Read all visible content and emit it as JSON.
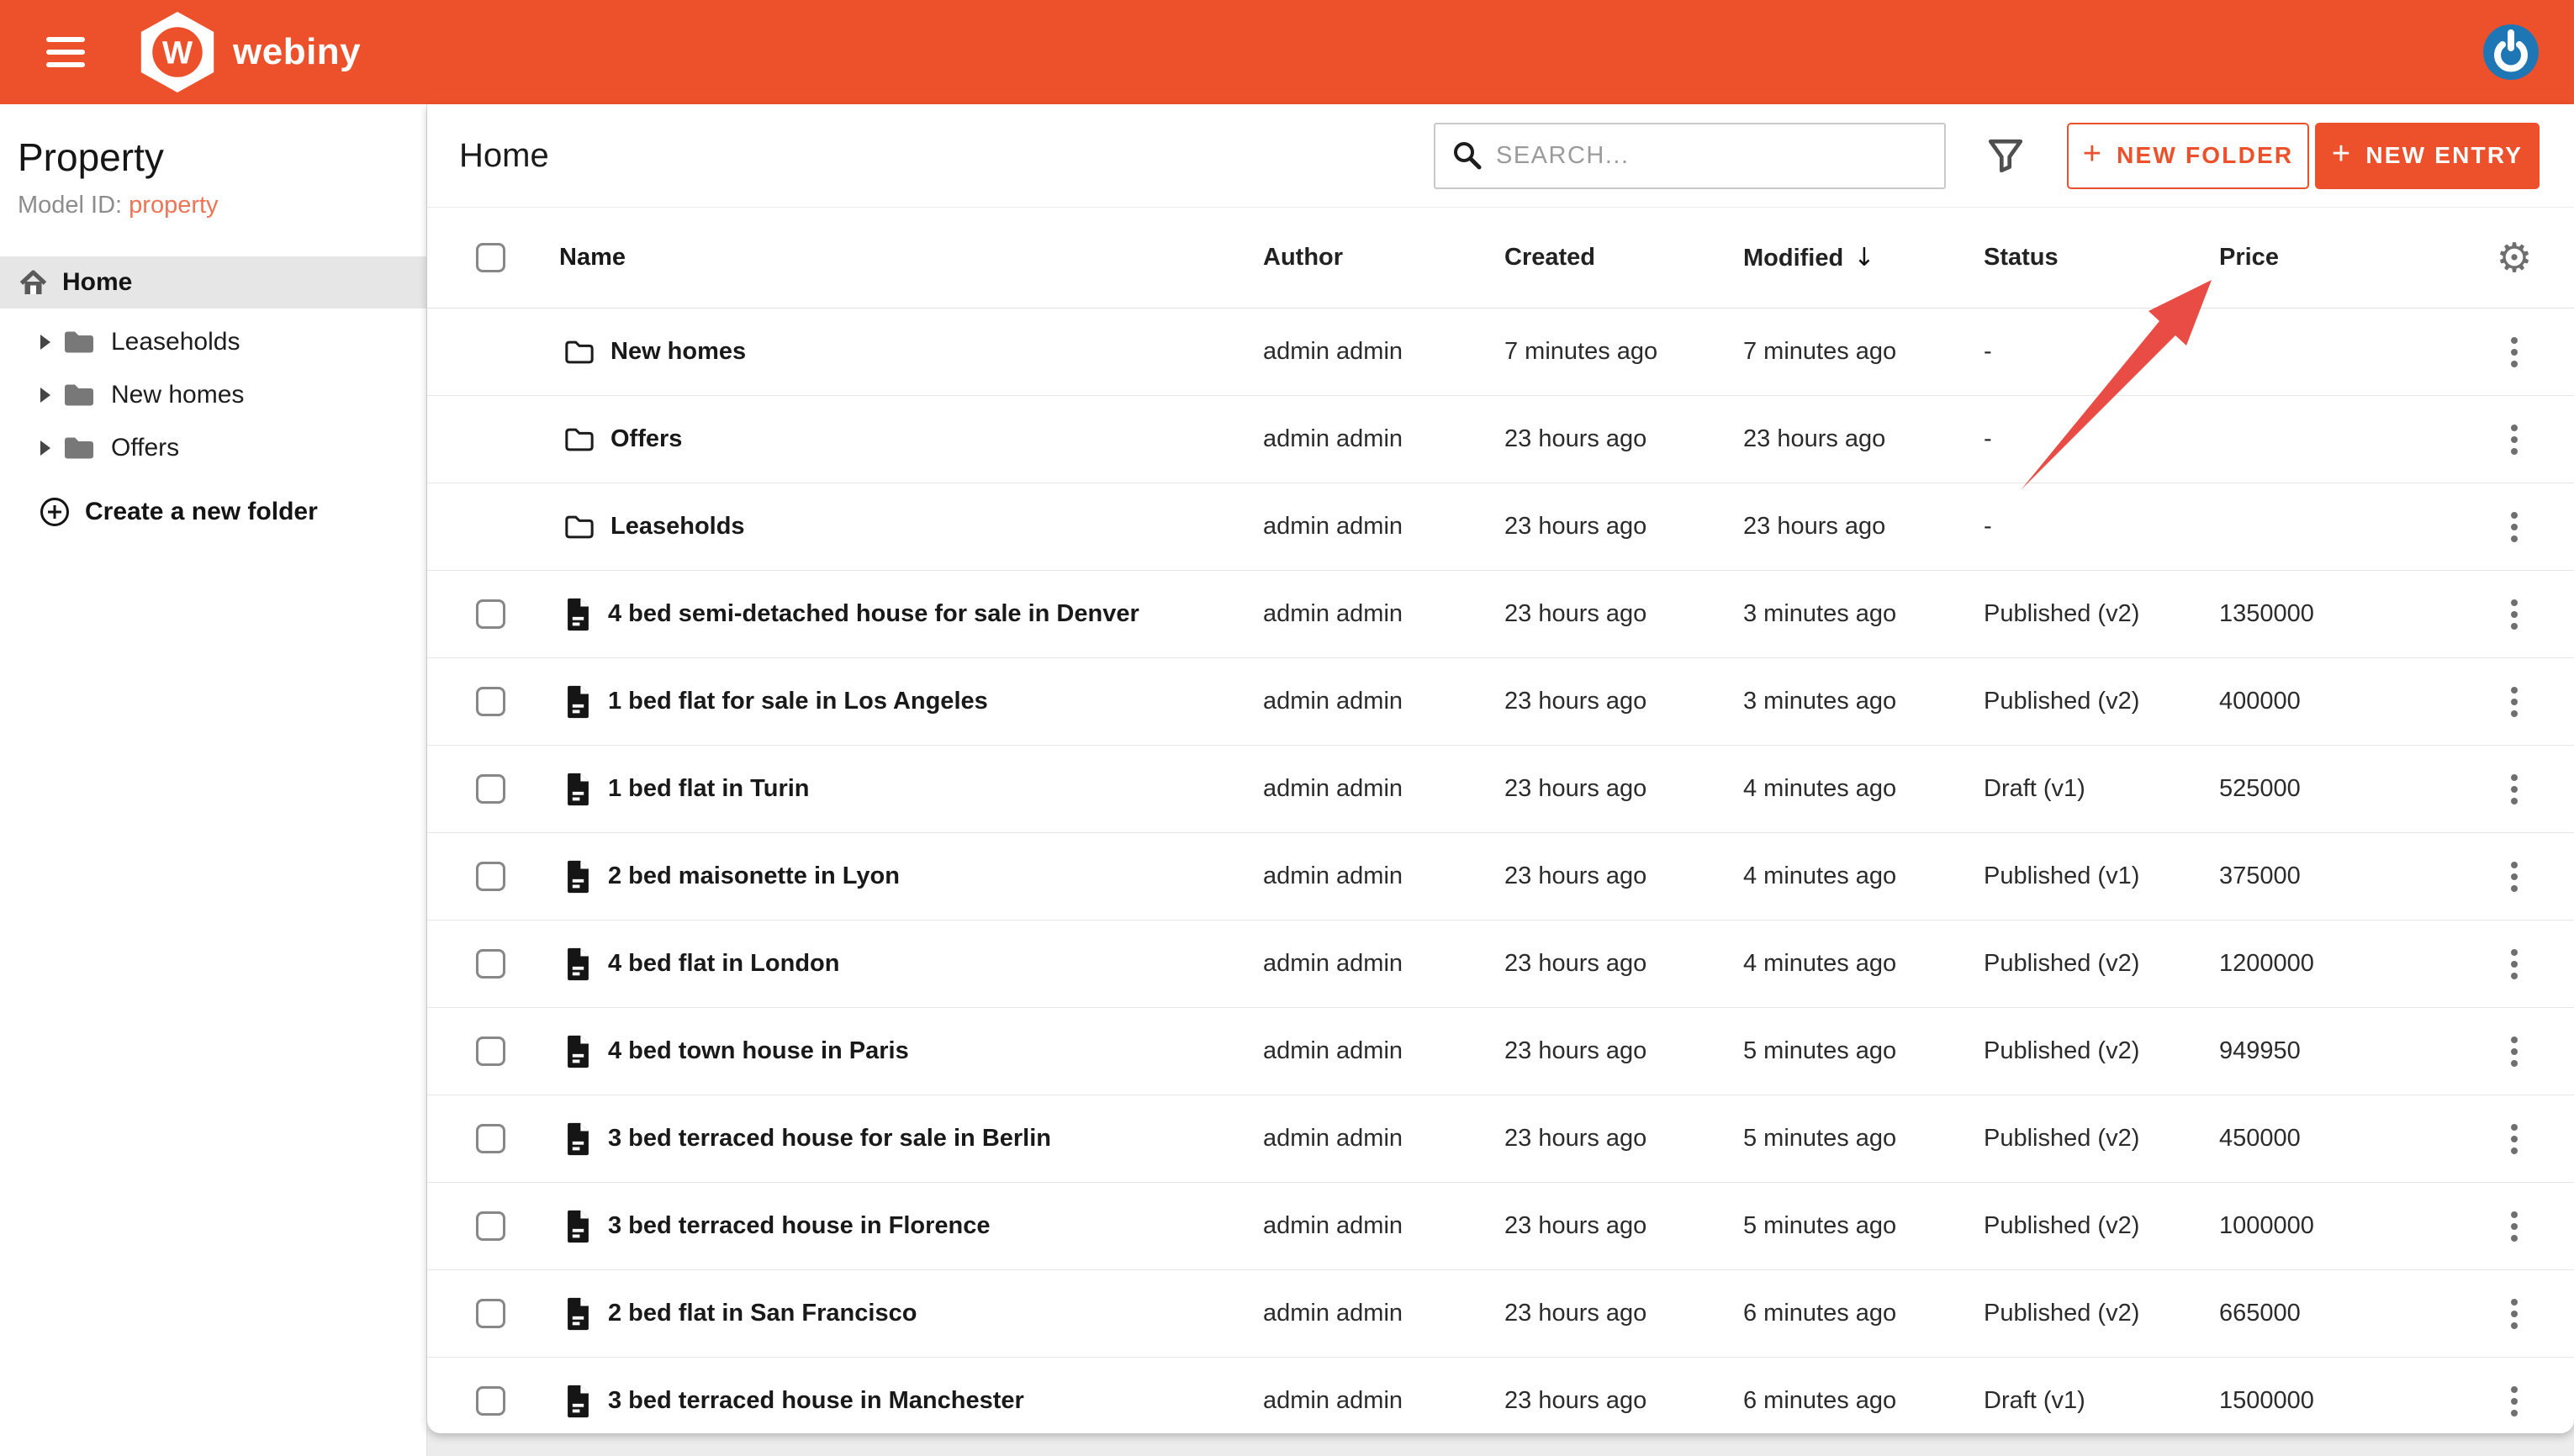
{
  "topbar": {
    "brand": "webiny",
    "brand_letter": "W"
  },
  "sidebar": {
    "title": "Property",
    "model_id_label": "Model ID:",
    "model_id_value": "property",
    "home_label": "Home",
    "folders": [
      {
        "label": "Leaseholds"
      },
      {
        "label": "New homes"
      },
      {
        "label": "Offers"
      }
    ],
    "create_folder_label": "Create a new folder"
  },
  "header": {
    "title": "Home",
    "search_placeholder": "SEARCH...",
    "buttons": {
      "plus_glyph": "+",
      "new_folder": "NEW FOLDER",
      "new_entry": "NEW ENTRY"
    }
  },
  "table": {
    "columns": {
      "name": "Name",
      "author": "Author",
      "created": "Created",
      "modified": "Modified",
      "status": "Status",
      "price": "Price"
    },
    "sort_arrow_glyph": "↓",
    "rows": [
      {
        "type": "folder",
        "name": "New homes",
        "author": "admin admin",
        "created": "7 minutes ago",
        "modified": "7 minutes ago",
        "status": "-",
        "price": ""
      },
      {
        "type": "folder",
        "name": "Offers",
        "author": "admin admin",
        "created": "23 hours ago",
        "modified": "23 hours ago",
        "status": "-",
        "price": ""
      },
      {
        "type": "folder",
        "name": "Leaseholds",
        "author": "admin admin",
        "created": "23 hours ago",
        "modified": "23 hours ago",
        "status": "-",
        "price": ""
      },
      {
        "type": "entry",
        "name": "4 bed semi-detached house for sale in Denver",
        "author": "admin admin",
        "created": "23 hours ago",
        "modified": "3 minutes ago",
        "status": "Published (v2)",
        "price": "1350000"
      },
      {
        "type": "entry",
        "name": "1 bed flat for sale in Los Angeles",
        "author": "admin admin",
        "created": "23 hours ago",
        "modified": "3 minutes ago",
        "status": "Published (v2)",
        "price": "400000"
      },
      {
        "type": "entry",
        "name": "1 bed flat in Turin",
        "author": "admin admin",
        "created": "23 hours ago",
        "modified": "4 minutes ago",
        "status": "Draft (v1)",
        "price": "525000"
      },
      {
        "type": "entry",
        "name": "2 bed maisonette in Lyon",
        "author": "admin admin",
        "created": "23 hours ago",
        "modified": "4 minutes ago",
        "status": "Published (v1)",
        "price": "375000"
      },
      {
        "type": "entry",
        "name": "4 bed flat in London",
        "author": "admin admin",
        "created": "23 hours ago",
        "modified": "4 minutes ago",
        "status": "Published (v2)",
        "price": "1200000"
      },
      {
        "type": "entry",
        "name": "4 bed town house in Paris",
        "author": "admin admin",
        "created": "23 hours ago",
        "modified": "5 minutes ago",
        "status": "Published (v2)",
        "price": "949950"
      },
      {
        "type": "entry",
        "name": "3 bed terraced house for sale in Berlin",
        "author": "admin admin",
        "created": "23 hours ago",
        "modified": "5 minutes ago",
        "status": "Published (v2)",
        "price": "450000"
      },
      {
        "type": "entry",
        "name": "3 bed terraced house in Florence",
        "author": "admin admin",
        "created": "23 hours ago",
        "modified": "5 minutes ago",
        "status": "Published (v2)",
        "price": "1000000"
      },
      {
        "type": "entry",
        "name": "2 bed flat in San Francisco",
        "author": "admin admin",
        "created": "23 hours ago",
        "modified": "6 minutes ago",
        "status": "Published (v2)",
        "price": "665000"
      },
      {
        "type": "entry",
        "name": "3 bed terraced house in Manchester",
        "author": "admin admin",
        "created": "23 hours ago",
        "modified": "6 minutes ago",
        "status": "Draft (v1)",
        "price": "1500000"
      }
    ]
  },
  "colors": {
    "primary": "#ed512c",
    "model_id": "#ee7456",
    "avatar_blue": "#1f76b5",
    "arrow_red": "#e8423a",
    "selected_bg": "#e6e6e6"
  }
}
